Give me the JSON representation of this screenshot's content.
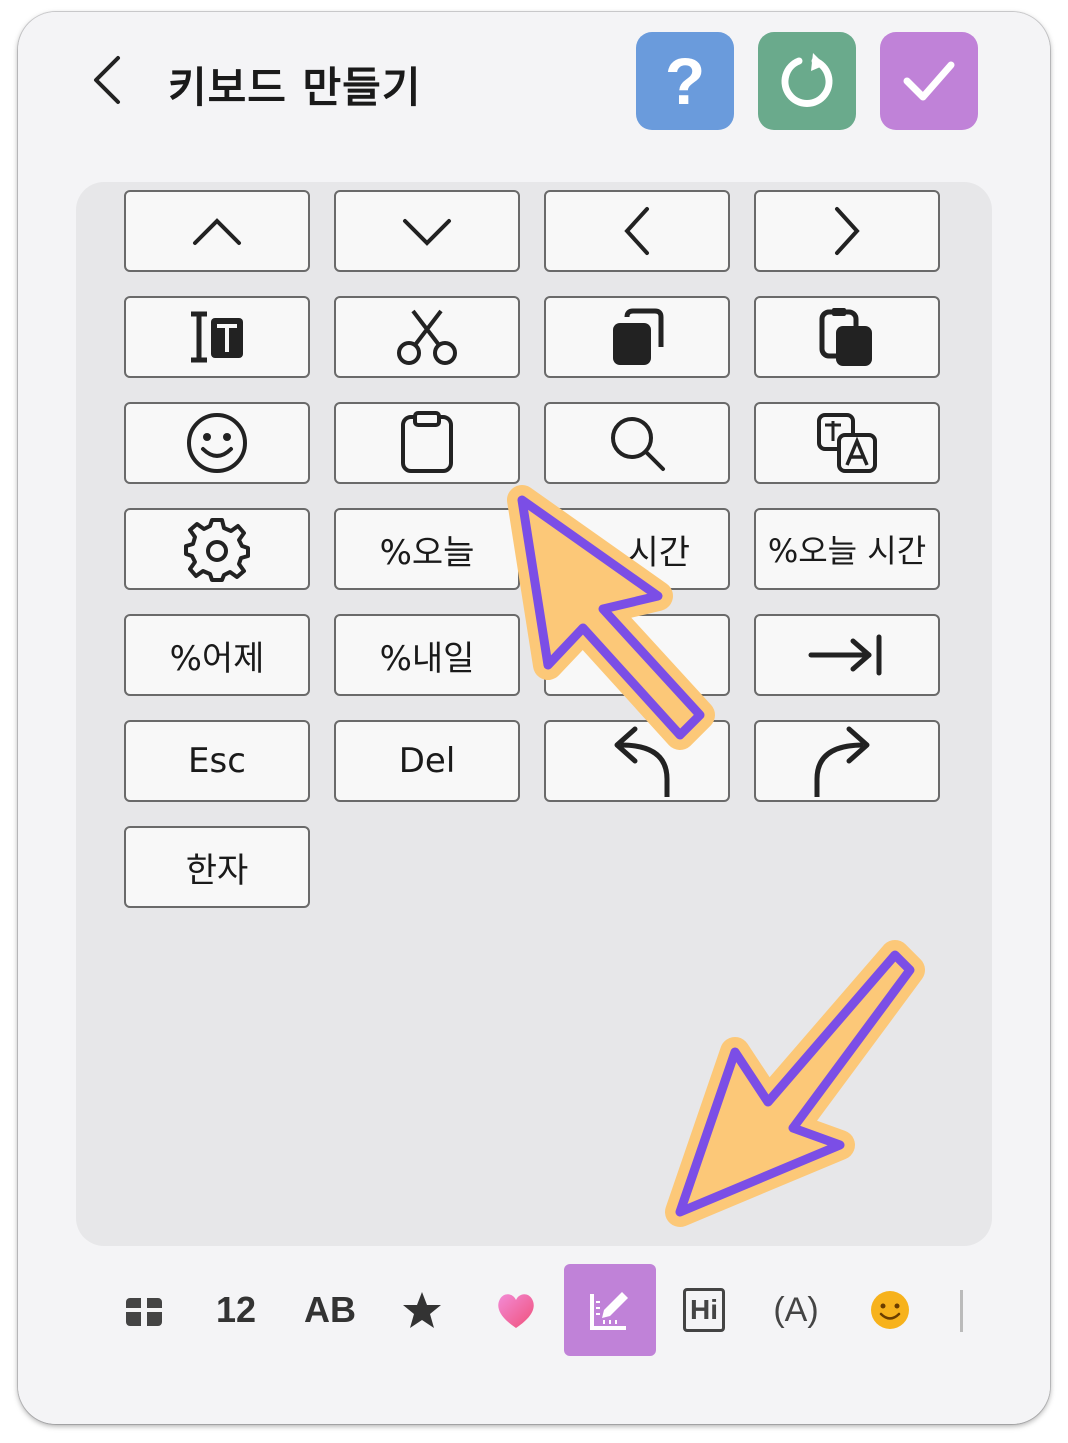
{
  "header": {
    "title": "키보드 만들기",
    "help_label": "?",
    "colors": {
      "help": "#6a9bdc",
      "reset": "#6aaa8c",
      "confirm": "#c082d8"
    },
    "icons": [
      "back-icon",
      "question-icon",
      "reset-icon",
      "check-icon"
    ]
  },
  "keys": {
    "row1": [
      "arrow-up-icon",
      "arrow-down-icon",
      "arrow-left-icon",
      "arrow-right-icon"
    ],
    "row2": [
      "select-all-icon",
      "cut-icon",
      "copy-icon",
      "paste-icon"
    ],
    "row3": [
      "emoji-icon",
      "clipboard-icon",
      "search-icon",
      "translate-icon"
    ],
    "today": "%오늘",
    "time": "시간",
    "today_time": "%오늘 시간",
    "yesterday": "%어제",
    "tomorrow": "%내일",
    "tab_icon": "tab-icon",
    "esc": "Esc",
    "del": "Del",
    "undo_icon": "undo-icon",
    "redo_icon": "redo-icon",
    "hanja": "한자"
  },
  "bottom_tabs": {
    "numbers": "12",
    "letters": "AB",
    "hi": "Hi",
    "paren_a": "(A)",
    "icons": [
      "gift-icon",
      "star-icon",
      "heart-icon",
      "edit-icon",
      "hi-box-icon",
      "paren-a-icon",
      "smiley-icon"
    ],
    "active": "edit",
    "active_color": "#c082d8"
  },
  "annotations": {
    "arrow_fill": "#fcc878",
    "arrow_stroke": "#7b4ee6"
  }
}
